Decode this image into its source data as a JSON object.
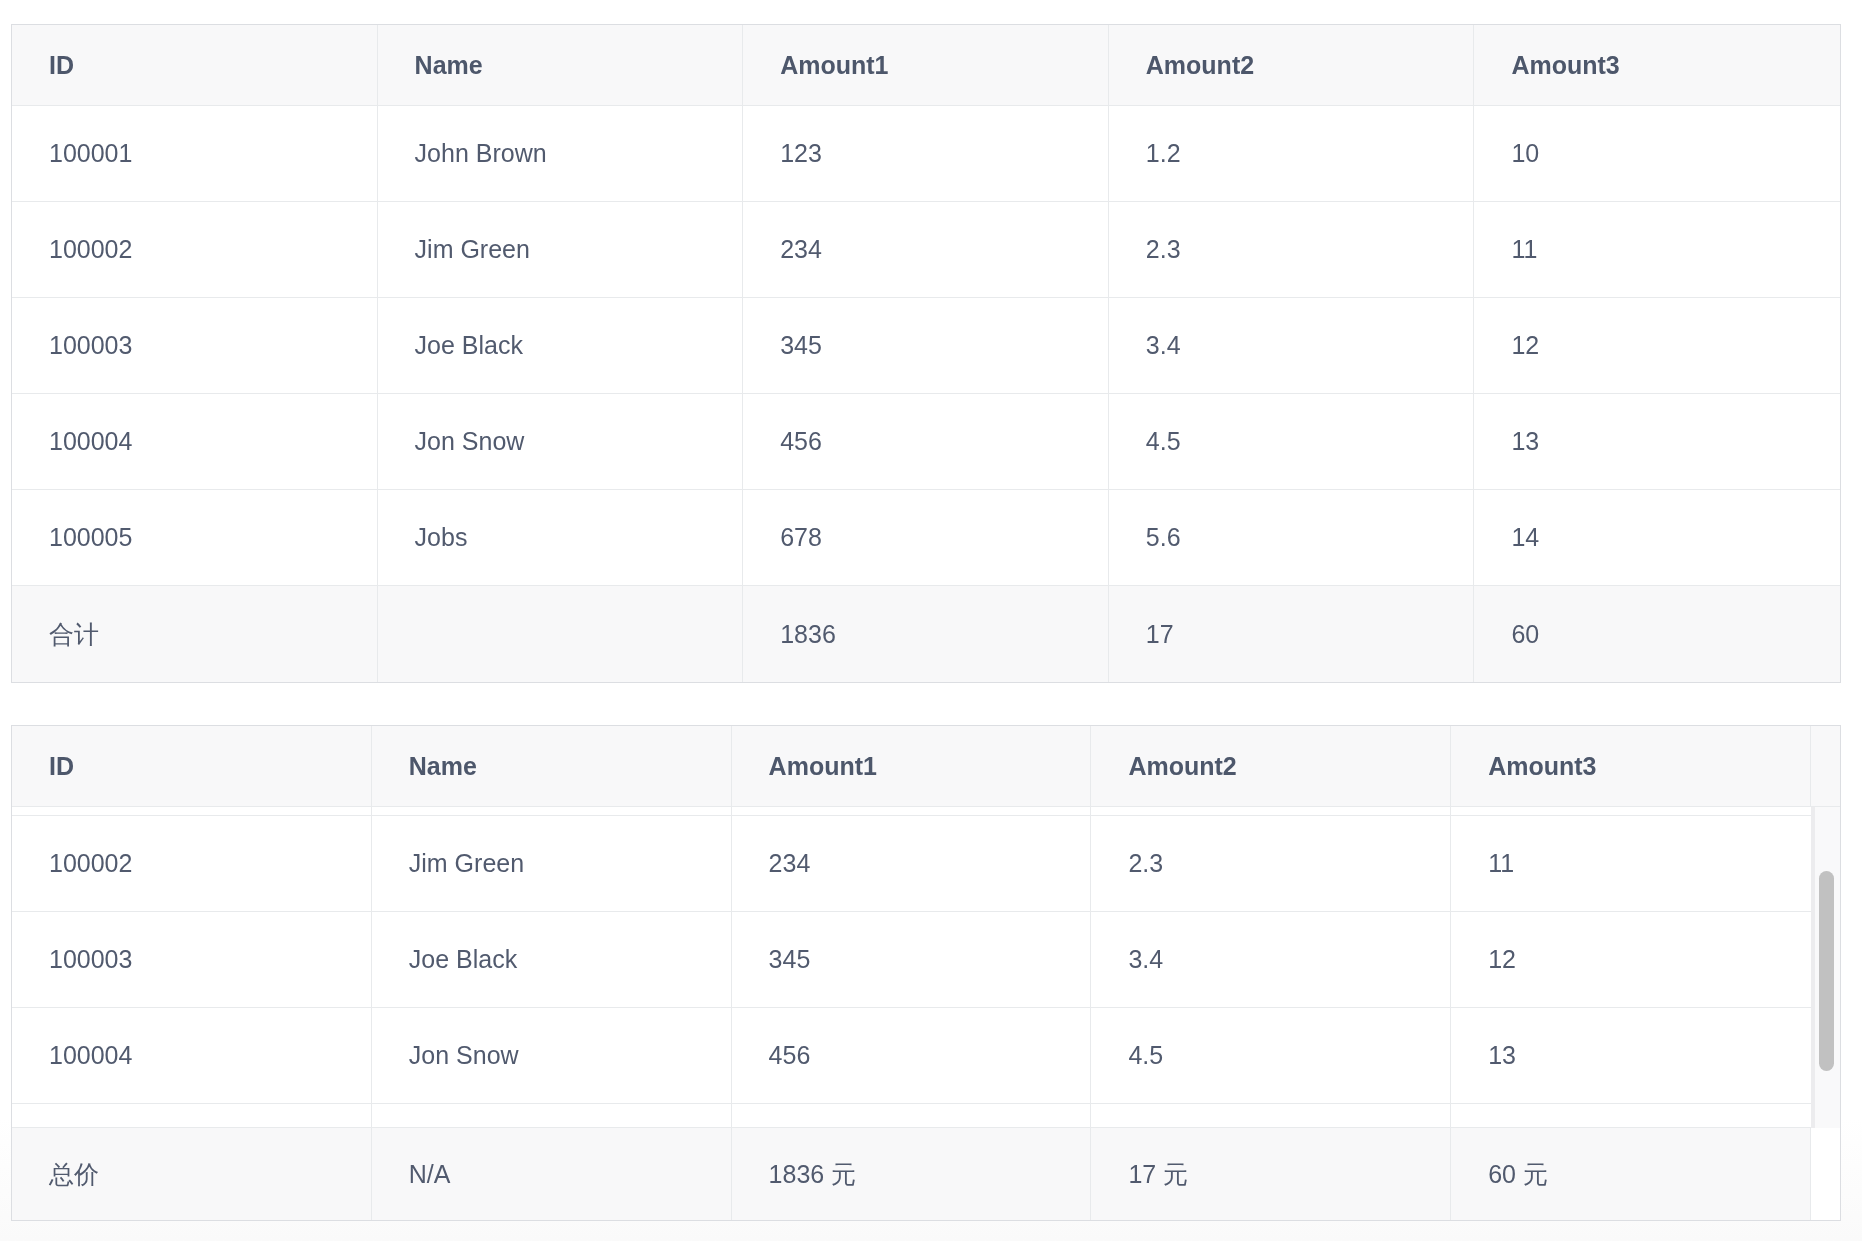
{
  "tables": [
    {
      "columns": [
        "ID",
        "Name",
        "Amount1",
        "Amount2",
        "Amount3"
      ],
      "rows": [
        [
          "100001",
          "John Brown",
          "123",
          "1.2",
          "10"
        ],
        [
          "100002",
          "Jim Green",
          "234",
          "2.3",
          "11"
        ],
        [
          "100003",
          "Joe Black",
          "345",
          "3.4",
          "12"
        ],
        [
          "100004",
          "Jon Snow",
          "456",
          "4.5",
          "13"
        ],
        [
          "100005",
          "Jobs",
          "678",
          "5.6",
          "14"
        ]
      ],
      "summary": {
        "label": "合计",
        "amounts": [
          "1836",
          "17",
          "60"
        ]
      },
      "scrollable": false
    },
    {
      "columns": [
        "ID",
        "Name",
        "Amount1",
        "Amount2",
        "Amount3"
      ],
      "rows": [
        [
          "100002",
          "Jim Green",
          "234",
          "2.3",
          "11"
        ],
        [
          "100003",
          "Joe Black",
          "345",
          "3.4",
          "12"
        ],
        [
          "100004",
          "Jon Snow",
          "456",
          "4.5",
          "13"
        ]
      ],
      "summary": {
        "label": "总价",
        "name": "N/A",
        "amounts": [
          "1836 元",
          "17 元",
          "60 元"
        ]
      },
      "scrollable": true
    }
  ]
}
